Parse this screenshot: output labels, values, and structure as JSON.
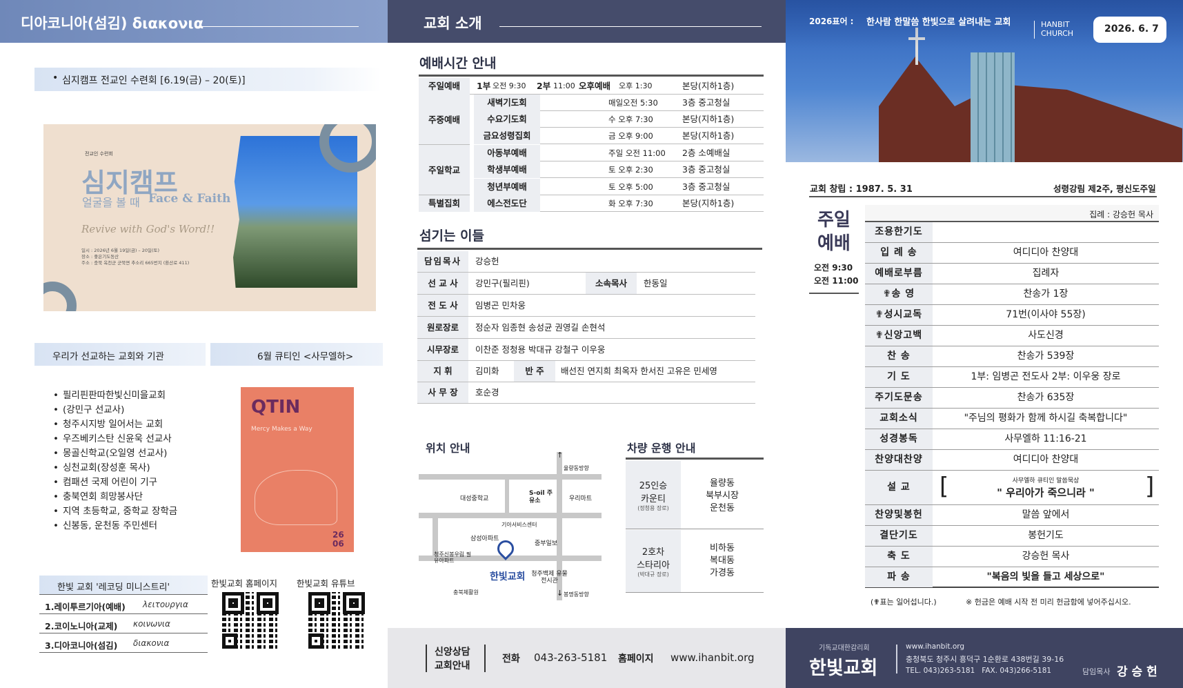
{
  "left": {
    "header_title": "디아코니아(섬김) διακονια",
    "retreat_note": "심지캠프 전교인 수련회 [6.19(금) – 20(토)]",
    "poster": {
      "kicker": "전교인 수련회",
      "title": "심지캠프",
      "subtitle_ko": "얼굴을 볼 때",
      "subtitle_en": "Face & Faith",
      "motto": "Revive with God's Word!!",
      "info1": "일시 : 2026년 6월 19일(금) – 20일(토)",
      "info2": "장소 : 좋은기도동산",
      "info3": "주소 : 충북 옥천군 군북면 추소리 665번지 (환산로 411)"
    },
    "mission_tab": "우리가 선교하는 교회와 기관",
    "qt_tab": "6월 큐티인 <사무엘하>",
    "missions": [
      "필리핀판따한빛신미을교회",
      "(강민구 선교사)",
      "청주시지방 일어서는 교회",
      "우즈베키스탄 신윤욱 선교사",
      "몽골신학교(오일영 선교사)",
      "싱천교회(장성훈 목사)",
      "컴패션 국제 어린이 기구",
      "충북연회 희망봉사단",
      "지역 초등학교, 중학교 장학금",
      "신봉동, 운천동 주민센터"
    ],
    "qt_book": {
      "logo": "QTIN",
      "tagline": "Mercy Makes a Way",
      "year": "26",
      "month": "06"
    },
    "record_title": "한빛 교회 '레코딩 미니스트리'",
    "records": [
      {
        "label": "1.레이투르기아(예배)",
        "greek": "λειτουργια"
      },
      {
        "label": "2.코이노니아(교제)",
        "greek": "κοινωνια"
      },
      {
        "label": "3.디아코니아(섬김)",
        "greek": "διακονια"
      }
    ],
    "homepage_label": "한빛교회 홈페이지",
    "youtube_label": "한빛교회 유튜브"
  },
  "middle": {
    "header_title": "교회 소개",
    "worship_title": "예배시간 안내",
    "worship": {
      "sunday_label": "주일예배",
      "sunday_1": "1부",
      "sunday_1_time": "오전 9:30",
      "sunday_2": "2부",
      "sunday_2_time": "11:00",
      "sunday_pm": "오후예배",
      "sunday_pm_time": "오후 1:30",
      "sunday_place": "본당(지하1층)",
      "weekday_label": "주중예배",
      "school_label": "주일학교",
      "special_label": "특별집회",
      "rows": [
        {
          "name": "새벽기도회",
          "time": "매일오전 5:30",
          "place": "3층 중고청실"
        },
        {
          "name": "수요기도회",
          "time": "수 오후 7:30",
          "place": "본당(지하1층)"
        },
        {
          "name": "금요성령집회",
          "time": "금 오후 9:00",
          "place": "본당(지하1층)"
        },
        {
          "name": "아동부예배",
          "time": "주일 오전 11:00",
          "place": "2층 소예배실"
        },
        {
          "name": "학생부예배",
          "time": "토 오후 2:30",
          "place": "3층 중고청실"
        },
        {
          "name": "청년부예배",
          "time": "토 오후 5:00",
          "place": "3층 중고청실"
        },
        {
          "name": "에스전도단",
          "time": "화 오후 7:30",
          "place": "본당(지하1층)"
        }
      ]
    },
    "staff_title": "섬기는 이들",
    "staff": {
      "pastor_label": "담임목사",
      "pastor": "강승헌",
      "missionary_label": "선 교 사",
      "missionary": "강민구(필리핀)",
      "assoc_label": "소속목사",
      "assoc": "한동일",
      "evangelist_label": "전 도 사",
      "evangelist": "임병곤 민차웅",
      "elder_label": "원로장로",
      "elders": "정순자 임종현 송성균 권영길 손현석",
      "active_label": "시무장로",
      "active": "이찬준 정청용 박대규 강철구 이우웅",
      "conductor_label": "지 휘",
      "conductor": "김미화",
      "accomp_label": "반 주",
      "accomp": "배선진 연지희 최옥자 한서진 고유은 민세영",
      "secretary_label": "사 무 장",
      "secretary": "호순경"
    },
    "location_title": "위치 안내",
    "map": {
      "north": "율량동방향",
      "south": "봉명동방향",
      "school": "대성중학교",
      "soil": "S-oil 주유소",
      "mart1": "우리마트",
      "giah": "기아서비스센터",
      "samsung": "삼성아파트",
      "jungbu": "중부일보",
      "shinbong": "청주신봉우림 필유아파트",
      "church": "한빛교회",
      "museum": "청주백제 유물전시관",
      "welfare": "충북체활원"
    },
    "vehicle_title": "차량 운행 안내",
    "vehicles": [
      {
        "car": "25인승",
        "model": "카운티",
        "driver": "(정청용 장로)",
        "stops": [
          "율량동",
          "북부시장",
          "운천동"
        ]
      },
      {
        "car": "2호차",
        "model": "스타리아",
        "driver": "(박대규 장로)",
        "stops": [
          "비하동",
          "복대동",
          "가경동"
        ]
      }
    ],
    "footer": {
      "counsel": "신앙상담",
      "guide": "교회안내",
      "phone_label": "전화",
      "phone": "043-263-5181",
      "web_label": "홈페이지",
      "web": "www.ihanbit.org"
    }
  },
  "right": {
    "banner_motto_prefix": "2026표어 : ",
    "banner_motto": "한사람 한말씀 한빛으로 살려내는 교회",
    "church_en1": "HANBIT",
    "church_en2": "CHURCH",
    "date": "2026. 6. 7",
    "founded": "교회 창립 : 1987. 5. 31",
    "season": "성령강림 제2주, 평신도주일",
    "sunday_title1": "주일",
    "sunday_title2": "예배",
    "time1": "오전 9:30",
    "time2": "오전 11:00",
    "presider": "집례 : 강승헌 목사",
    "order": [
      {
        "label": "조용한기도",
        "value": ""
      },
      {
        "label": "입 례 송",
        "value": "여디디아 찬양대"
      },
      {
        "label": "예배로부름",
        "value": "집례자"
      },
      {
        "label": "✟송 영",
        "value": "찬송가 1장"
      },
      {
        "label": "✟성시교독",
        "value": "71번(이사야 55장)"
      },
      {
        "label": "✟신앙고백",
        "value": "사도신경"
      },
      {
        "label": "찬 송",
        "value": "찬송가 539장"
      },
      {
        "label": "기 도",
        "value": "1부: 임병곤 전도사 2부: 이우웅 장로"
      },
      {
        "label": "주기도문송",
        "value": "찬송가 635장"
      },
      {
        "label": "교회소식",
        "value": "\"주님의 평화가 함께 하시길 축복합니다\""
      },
      {
        "label": "성경봉독",
        "value": "사무엘하 11:16-21"
      },
      {
        "label": "찬양대찬양",
        "value": "여디디아 찬양대"
      }
    ],
    "sermon_label": "설 교",
    "sermon_sub": "사무엘하 큐티인 말씀묵상",
    "sermon_title": "\" 우리아가 죽으니라 \"",
    "order2": [
      {
        "label": "찬양및봉헌",
        "value": "말씀 앞에서"
      },
      {
        "label": "결단기도",
        "value": "봉헌기도"
      },
      {
        "label": "축 도",
        "value": "강승헌 목사"
      },
      {
        "label": "파 송",
        "value": "\"복음의 빛을 들고 세상으로\""
      }
    ],
    "note_left": "(✟표는 일어섭니다.)",
    "note_right": "※ 헌금은 예배 시작 전 미리 헌금함에 넣어주십시오.",
    "footer": {
      "denom": "기독교대한감리회",
      "name": "한빛교회",
      "web": "www.ihanbit.org",
      "address": "충청북도 청주시 흥덕구 1순환로 438번길 39-16",
      "tel": "TEL. 043)263-5181   FAX. 043)266-5181",
      "pastor_label": "담임목사",
      "pastor": "강 승 헌"
    }
  },
  "colors": {
    "left_header": "#6f88b9",
    "mid_header": "#454c6b",
    "footer_gray": "#e7e7ea",
    "right_footer": "#3f4461",
    "poster_bg": "#efdfcf",
    "qt_bg": "#e98066"
  }
}
